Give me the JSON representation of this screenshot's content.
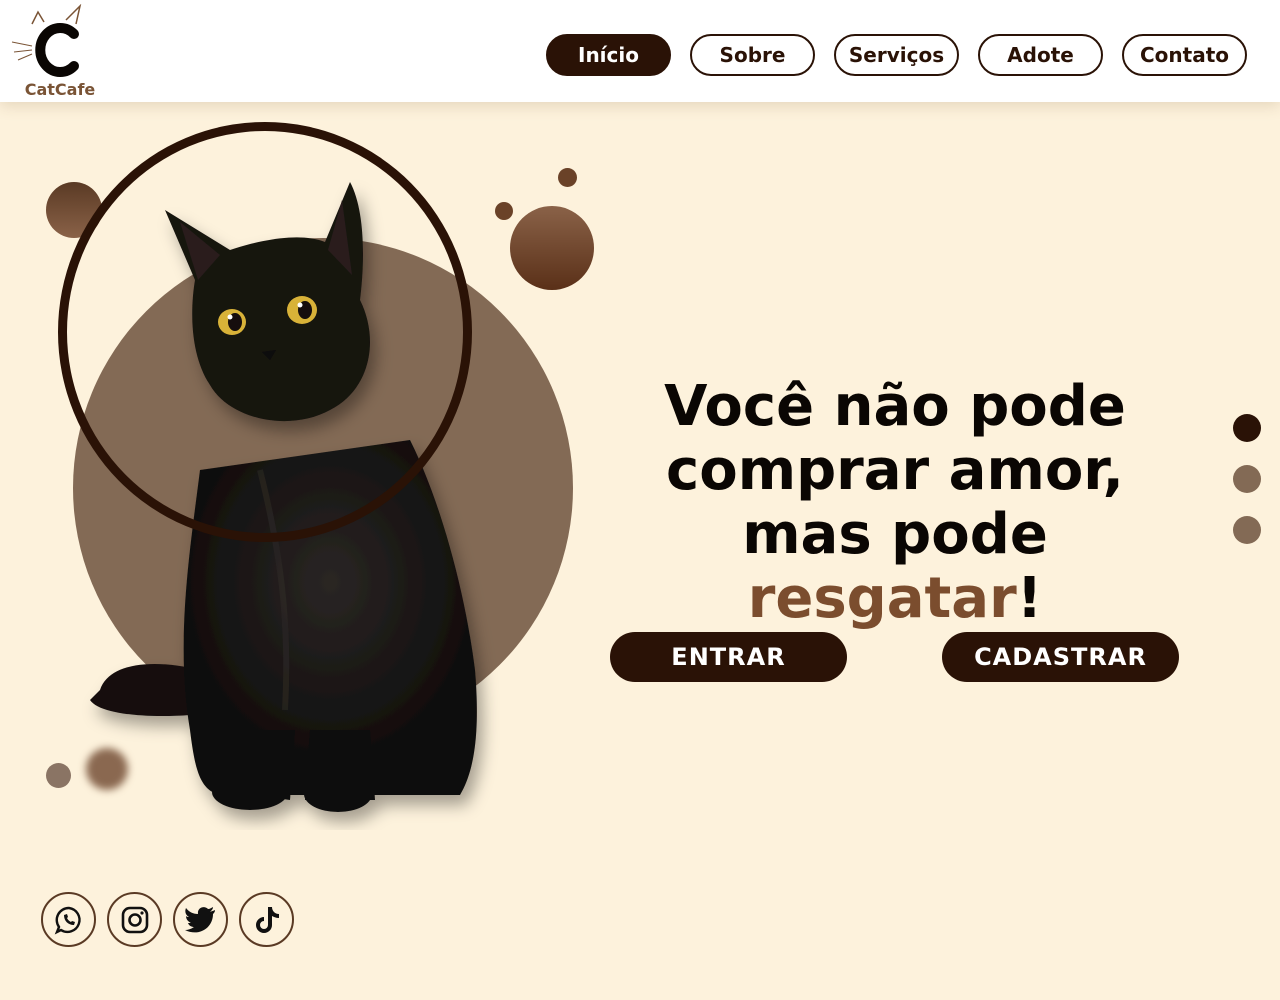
{
  "brand": {
    "name": "CatCafe",
    "logo_letter": "C",
    "icon": "cat-logo-icon"
  },
  "nav": {
    "items": [
      {
        "label": "Início",
        "active": true
      },
      {
        "label": "Sobre",
        "active": false
      },
      {
        "label": "Serviços",
        "active": false
      },
      {
        "label": "Adote",
        "active": false
      },
      {
        "label": "Contato",
        "active": false
      }
    ]
  },
  "hero": {
    "headline_part1": "Você não pode comprar amor, mas pode ",
    "headline_accent": "resgatar",
    "headline_end": "!",
    "image": "black-cat-photo",
    "buttons": {
      "enter": "ENTRAR",
      "register": "CADASTRAR"
    }
  },
  "carousel": {
    "dots": 3,
    "active_index": 0
  },
  "social": [
    {
      "name": "whatsapp-icon"
    },
    {
      "name": "instagram-icon"
    },
    {
      "name": "twitter-icon"
    },
    {
      "name": "tiktok-icon"
    }
  ],
  "colors": {
    "background": "#fdf2dc",
    "primary_dark": "#2a1206",
    "accent_brown": "#7b4d2e",
    "muted_brown": "#836a55"
  }
}
